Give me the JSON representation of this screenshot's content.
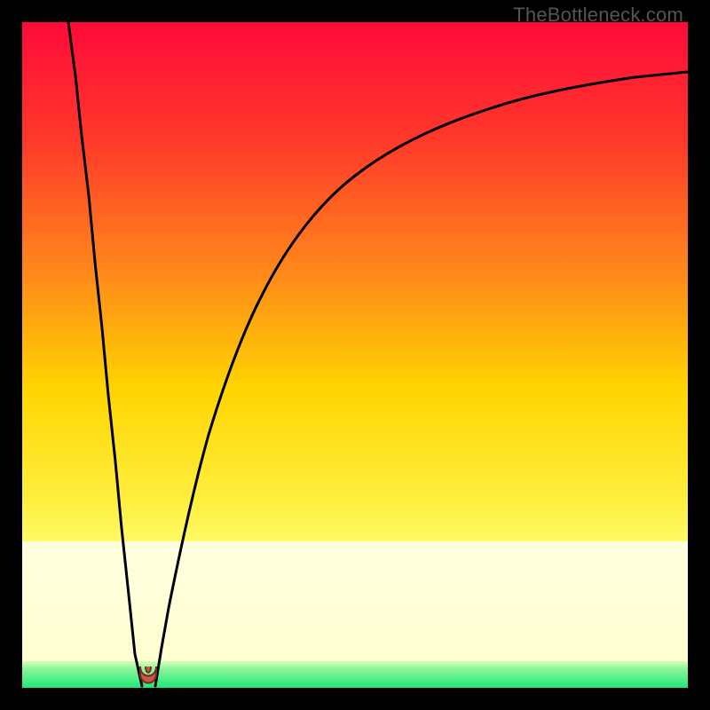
{
  "watermark": "TheBottleneck.com",
  "colors": {
    "bg": "#000000",
    "grad_top": "#ff0a3a",
    "grad_mid1": "#ff6a1a",
    "grad_mid2": "#ffd400",
    "grad_mid3": "#ffef60",
    "grad_mid4": "#f7ff70",
    "grad_bottom": "#1ee87a",
    "curve": "#000000",
    "marker_fill": "#c65a44",
    "marker_stroke": "#7a2a1e"
  },
  "chart_data": {
    "type": "line",
    "title": "",
    "xlabel": "",
    "ylabel": "",
    "xlim": [
      0,
      100
    ],
    "ylim": [
      0,
      100
    ],
    "series": [
      {
        "name": "bottleneck-curve-left",
        "x": [
          7,
          8,
          9,
          10,
          11,
          12,
          13,
          14,
          15,
          16,
          17,
          18
        ],
        "y": [
          100,
          92,
          83,
          74,
          64,
          54,
          44,
          34,
          24,
          14,
          5,
          0
        ]
      },
      {
        "name": "bottleneck-curve-right",
        "x": [
          20,
          21,
          22,
          24,
          26,
          28,
          30,
          33,
          36,
          40,
          45,
          50,
          56,
          63,
          71,
          80,
          90,
          100
        ],
        "y": [
          0,
          6,
          12,
          22,
          31,
          39,
          46,
          54,
          60,
          66,
          72,
          77,
          81,
          84,
          87,
          89,
          91,
          92
        ]
      }
    ],
    "optimum_marker": {
      "x": 19,
      "y": 1.5,
      "shape": "u"
    },
    "green_band_y": [
      0,
      4
    ],
    "pale_band_y": [
      4,
      22
    ]
  }
}
